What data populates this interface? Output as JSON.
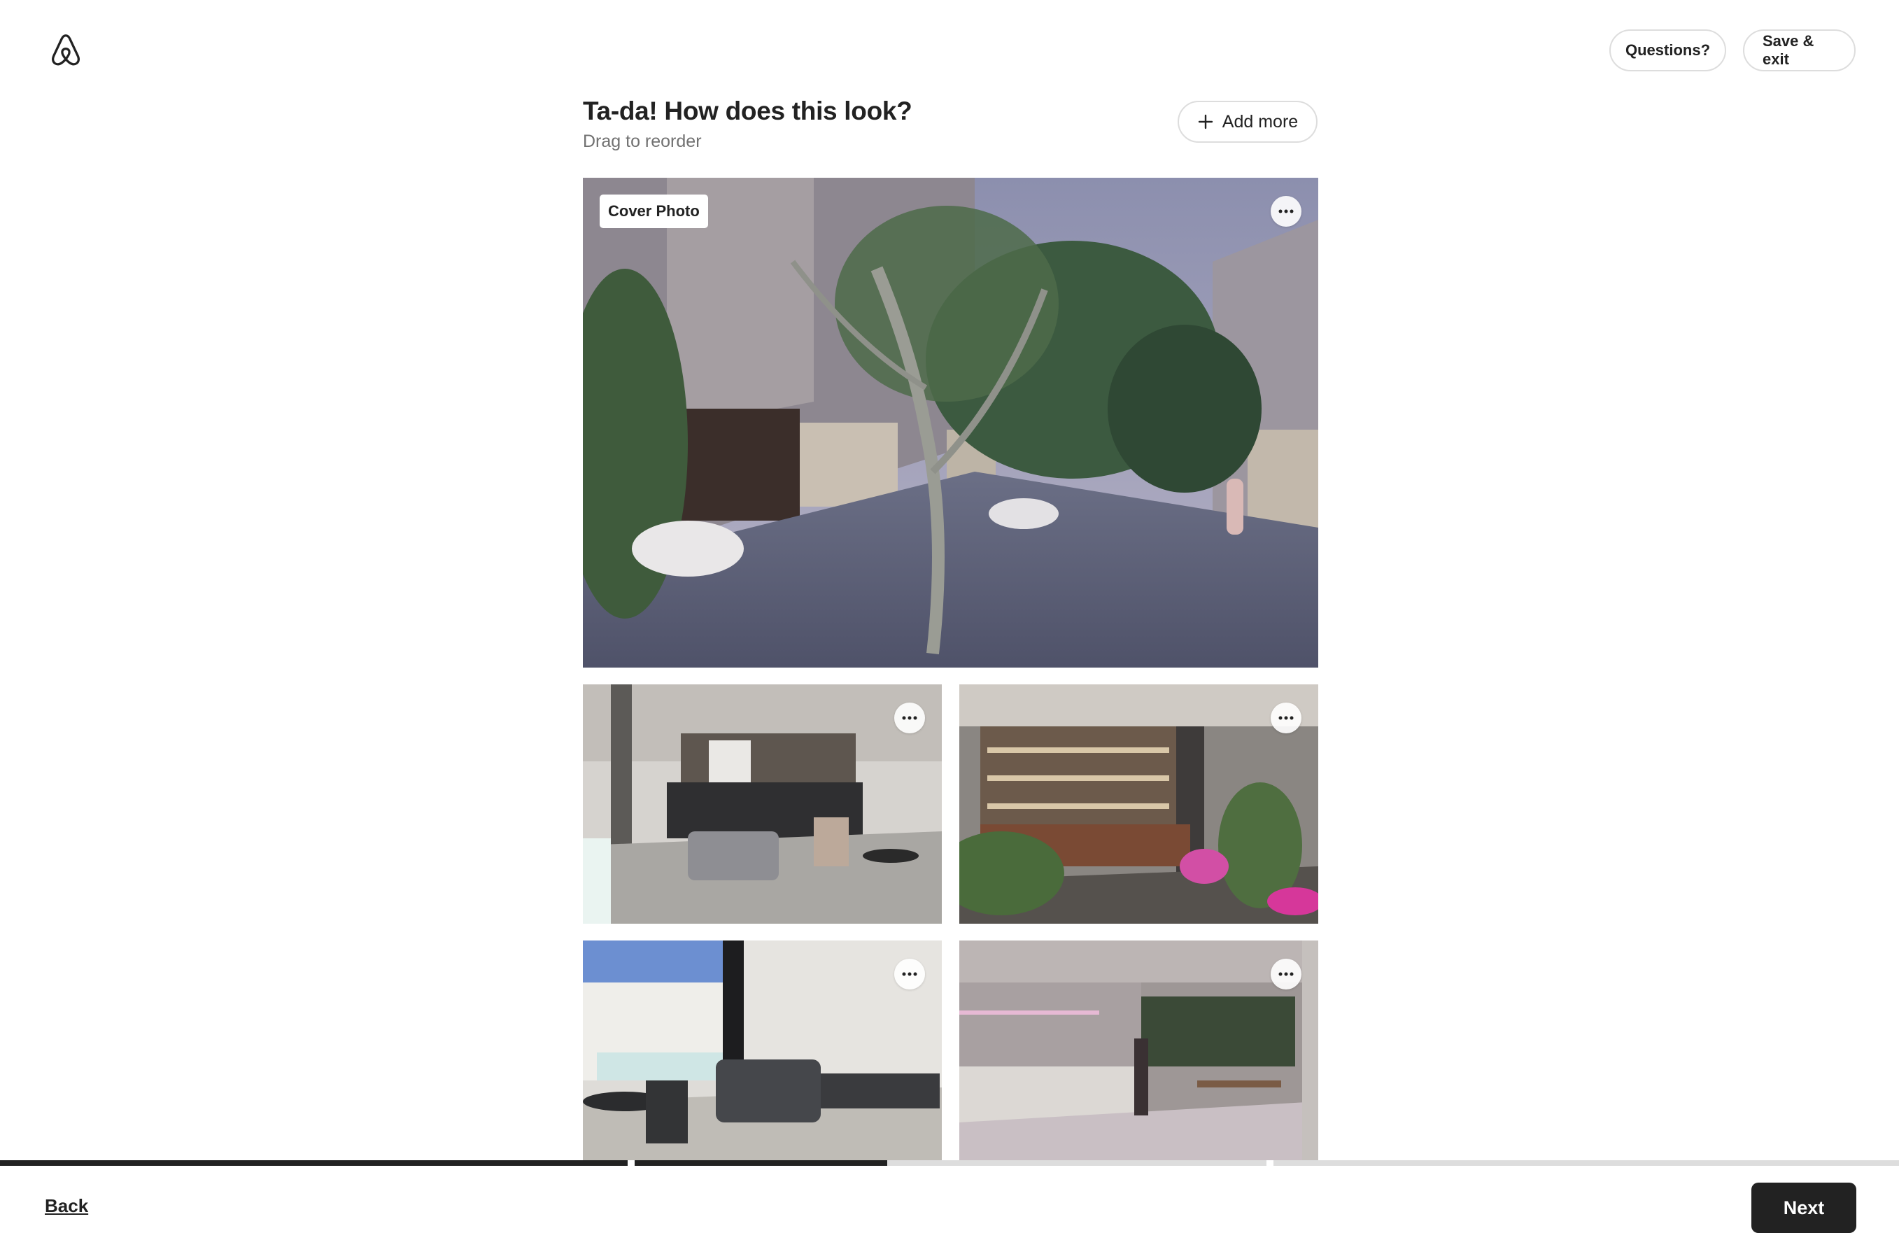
{
  "header": {
    "logo_icon": "airbnb-logo-icon",
    "questions_label": "Questions?",
    "save_exit_label": "Save & exit"
  },
  "main": {
    "title": "Ta-da! How does this look?",
    "subtitle": "Drag to reorder",
    "add_more_label": "Add more",
    "add_icon": "plus-icon",
    "cover_badge": "Cover Photo",
    "more_icon": "ellipsis-icon",
    "photo_count": 5
  },
  "footer": {
    "back_label": "Back",
    "next_label": "Next",
    "progress": [
      1.0,
      0.4,
      0.0
    ]
  },
  "colors": {
    "text": "#222222",
    "muted": "#717171",
    "border": "#dddddd",
    "button_dark": "#222222"
  }
}
